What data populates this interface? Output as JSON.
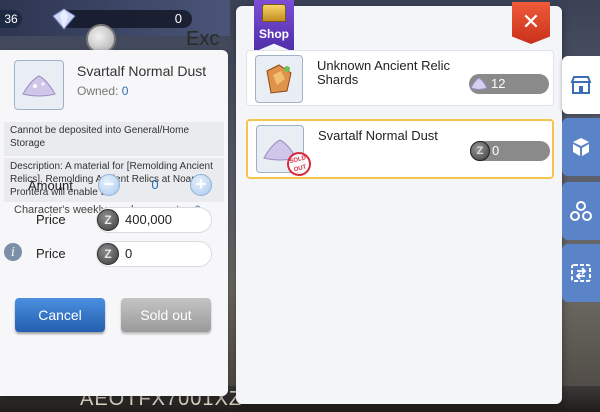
{
  "hud": {
    "level": "36",
    "currency_value": "0",
    "background_label": "Exc",
    "bottom_text": "AEOTFX7001XZ"
  },
  "detail": {
    "item_name": "Svartalf Normal Dust",
    "owned_label": "Owned:",
    "owned_value": "0",
    "warning": "Cannot be deposited into General/Home Storage",
    "description": "Description: A material for [Remolding Ancient Relics]. Remolding Ancient Relics at Noan in Prontera will enable the",
    "quota_label": "Character's weekly purchase quota :",
    "quota_value": "0",
    "amount_label": "Amount",
    "amount_value": "0",
    "price_label": "Price",
    "price_value": "400,000",
    "price2_label": "Price",
    "price2_value": "0",
    "zeny_symbol": "Z",
    "cancel_label": "Cancel",
    "soldout_label": "Sold out"
  },
  "shop": {
    "title": "Shop",
    "close_symbol": "✕",
    "items": [
      {
        "name": "Unknown Ancient Relic Shards",
        "cost": "12",
        "cost_icon": "dust-icon"
      },
      {
        "name": "Svartalf Normal Dust",
        "cost": "0",
        "cost_icon": "zeny-coin-icon",
        "badge": "SOLD OUT"
      }
    ]
  },
  "tabs": [
    "store-tab",
    "cube-tab",
    "molecule-tab",
    "exchange-tab"
  ],
  "colors": {
    "accent_blue": "#2a6fb0",
    "highlight_gold": "#f3c54b",
    "close_red": "#d93a22",
    "tab_blue": "#5b84c8"
  }
}
